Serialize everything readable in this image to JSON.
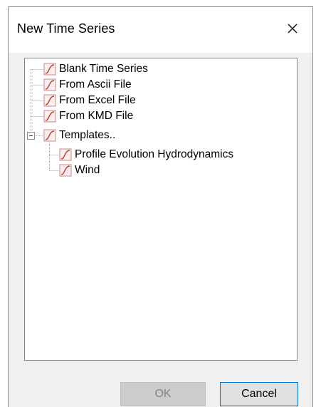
{
  "window": {
    "title": "New Time Series",
    "close_symbol": "✕"
  },
  "tree": {
    "items": [
      {
        "label": "Blank Time Series",
        "icon": "time-series-icon"
      },
      {
        "label": "From Ascii File",
        "icon": "time-series-icon"
      },
      {
        "label": "From Excel File",
        "icon": "time-series-icon"
      },
      {
        "label": "From KMD File",
        "icon": "time-series-icon"
      },
      {
        "label": "Templates..",
        "icon": "time-series-icon",
        "expanded": true,
        "children": [
          {
            "label": "Profile Evolution Hydrodynamics",
            "icon": "time-series-icon"
          },
          {
            "label": "Wind",
            "icon": "time-series-icon"
          }
        ]
      }
    ]
  },
  "buttons": {
    "ok_label": "OK",
    "ok_enabled": false,
    "cancel_label": "Cancel"
  },
  "colors": {
    "icon_curve": "#c0392b",
    "focus_border": "#0078d7"
  }
}
